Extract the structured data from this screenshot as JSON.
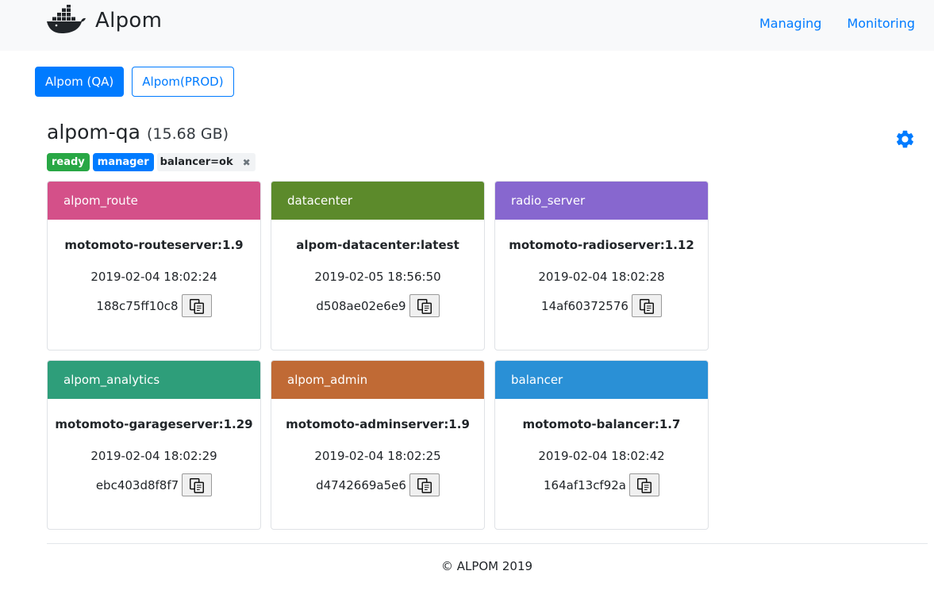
{
  "brand": {
    "name": "Alpom"
  },
  "nav": {
    "managing": "Managing",
    "monitoring": "Monitoring"
  },
  "envs": [
    {
      "label": "Alpom (QA)",
      "active": true
    },
    {
      "label": "Alpom(PROD)",
      "active": false
    }
  ],
  "node": {
    "name": "alpom-qa",
    "size": "(15.68 GB)",
    "status": "ready",
    "role": "manager",
    "label": "balancer=ok"
  },
  "colors": {
    "accent": "#007bff",
    "ready": "#28a745",
    "route": "#d45089",
    "datacenter": "#5c8a2b",
    "radio": "#8767cf",
    "analytics": "#2e9e7a",
    "admin": "#c06a35",
    "balancer": "#2a90d6"
  },
  "services": [
    {
      "name": "alpom_route",
      "image": "motomoto-routeserver:1.9",
      "created": "2019-02-04 18:02:24",
      "id": "188c75ff10c8"
    },
    {
      "name": "datacenter",
      "image": "alpom-datacenter:latest",
      "created": "2019-02-05 18:56:50",
      "id": "d508ae02e6e9"
    },
    {
      "name": "radio_server",
      "image": "motomoto-radioserver:1.12",
      "created": "2019-02-04 18:02:28",
      "id": "14af60372576"
    },
    {
      "name": "alpom_analytics",
      "image": "motomoto-garageserver:1.29",
      "created": "2019-02-04 18:02:29",
      "id": "ebc403d8f8f7"
    },
    {
      "name": "alpom_admin",
      "image": "motomoto-adminserver:1.9",
      "created": "2019-02-04 18:02:25",
      "id": "d4742669a5e6"
    },
    {
      "name": "balancer",
      "image": "motomoto-balancer:1.7",
      "created": "2019-02-04 18:02:42",
      "id": "164af13cf92a"
    }
  ],
  "footer": {
    "text": "© ALPOM 2019"
  }
}
